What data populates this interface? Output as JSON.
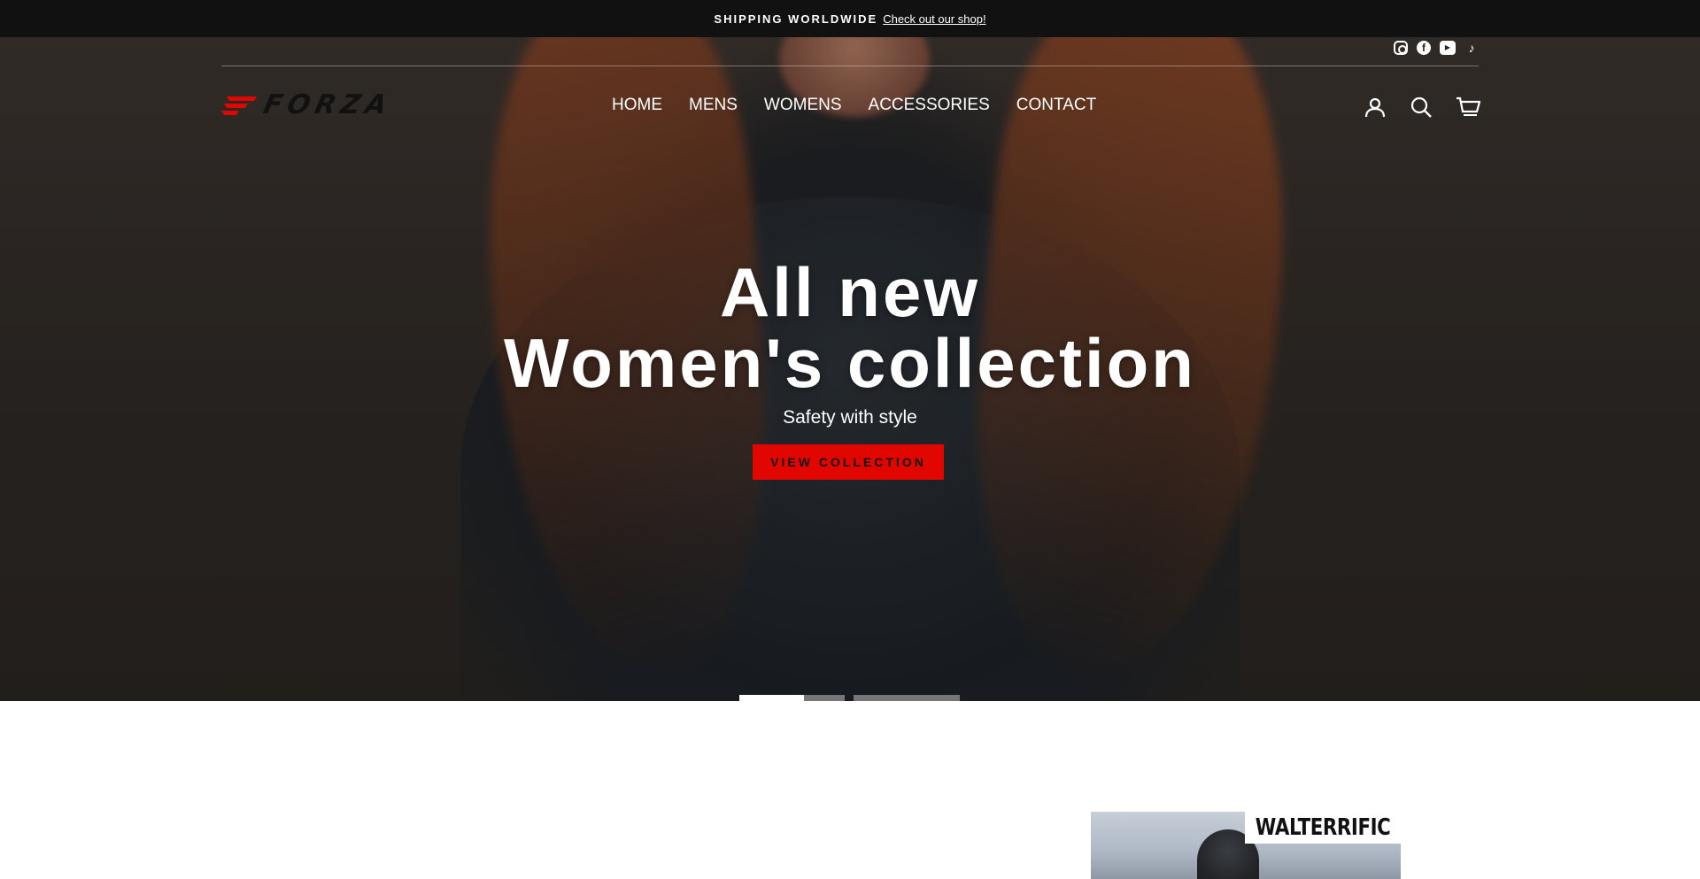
{
  "announcement": {
    "strong": "SHIPPING WORLDWIDE",
    "link": "Check out our shop!"
  },
  "social": [
    {
      "name": "instagram-icon"
    },
    {
      "name": "facebook-icon"
    },
    {
      "name": "youtube-icon"
    },
    {
      "name": "tiktok-icon"
    }
  ],
  "brand": {
    "name": "FORZA",
    "accent": "#e10600"
  },
  "nav": {
    "home": "HOME",
    "mens": "MENS",
    "womens": "WOMENS",
    "accessories": "ACCESSORIES",
    "contact": "CONTACT"
  },
  "hero": {
    "title_line1": "All new",
    "title_line2": "Women's collection",
    "subtitle": "Safety with style",
    "button": "VIEW COLLECTION",
    "slides": [
      {
        "active": true
      },
      {
        "active": false
      },
      {
        "active": false
      }
    ]
  },
  "featured": {
    "label": "WALTERRIFIC"
  }
}
